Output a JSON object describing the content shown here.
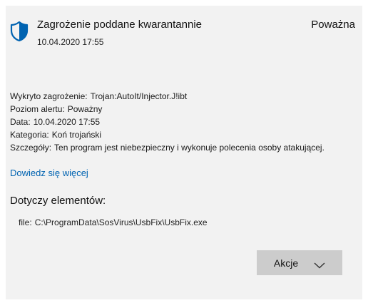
{
  "alert": {
    "title": "Zagrożenie poddane kwarantannie",
    "timestamp": "10.04.2020 17:55",
    "severity": "Poważna"
  },
  "details": [
    {
      "label": "Wykryto zagrożenie:",
      "value": "Trojan:AutoIt/Injector.J!ibt"
    },
    {
      "label": "Poziom alertu:",
      "value": "Poważny"
    },
    {
      "label": "Data:",
      "value": "10.04.2020 17:55"
    },
    {
      "label": "Kategoria:",
      "value": "Koń trojański"
    },
    {
      "label": "Szczegóły:",
      "value": "Ten program jest niebezpieczny i wykonuje polecenia osoby atakującej."
    }
  ],
  "learn_more": "Dowiedz się więcej",
  "affected": {
    "heading": "Dotyczy elementów:",
    "items": [
      {
        "label": "file:",
        "value": "C:\\ProgramData\\SosVirus\\UsbFix\\UsbFix.exe"
      }
    ]
  },
  "actions_button": {
    "label": "Akcje"
  },
  "icons": {
    "shield": "shield-icon",
    "chevron": "chevron-down-icon"
  },
  "colors": {
    "panel_bg": "#f2f2f2",
    "link": "#0063b1",
    "shield": "#0063b1",
    "button_bg": "#cccccc"
  }
}
